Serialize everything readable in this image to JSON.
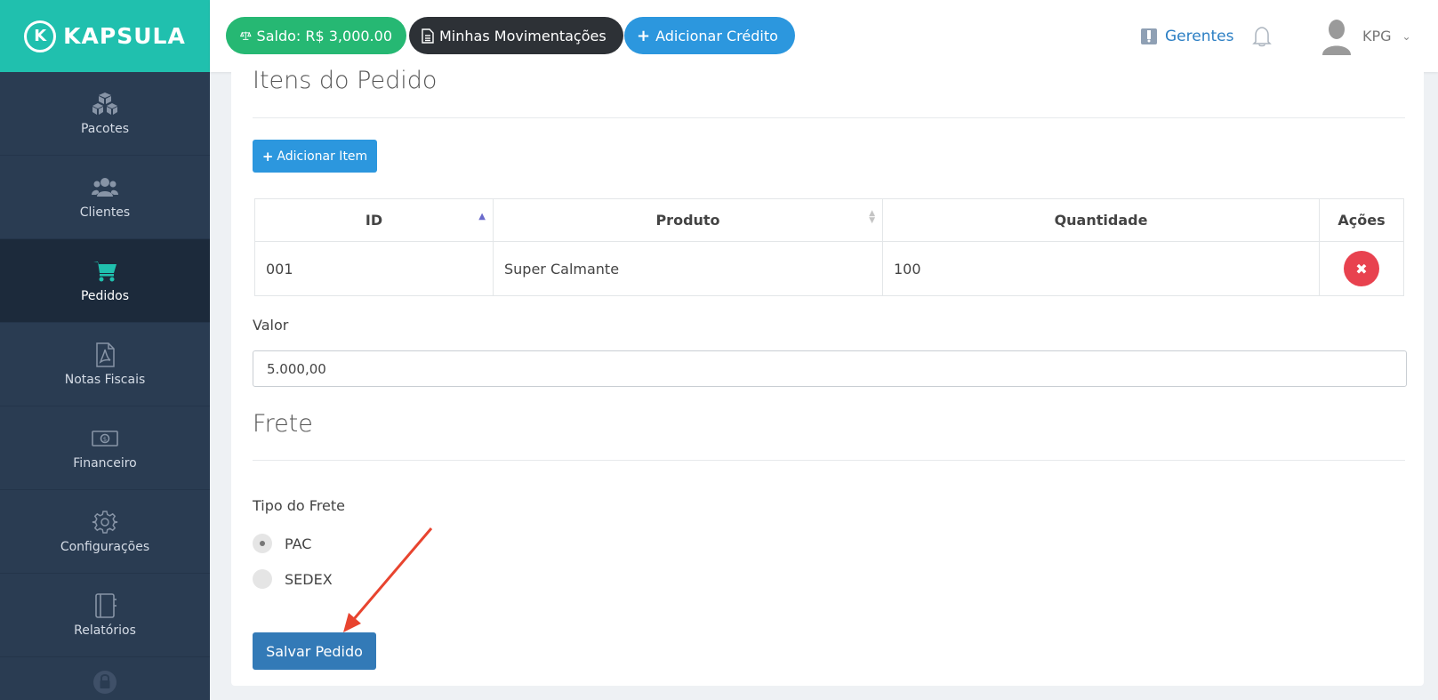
{
  "app": {
    "name": "KAPSULA",
    "logo_letter": "K"
  },
  "sidebar": {
    "items": [
      {
        "label": "Pacotes",
        "icon": "cubes-icon"
      },
      {
        "label": "Clientes",
        "icon": "users-icon"
      },
      {
        "label": "Pedidos",
        "icon": "cart-icon",
        "active": true
      },
      {
        "label": "Notas Fiscais",
        "icon": "pdf-file-icon"
      },
      {
        "label": "Financeiro",
        "icon": "money-icon"
      },
      {
        "label": "Configurações",
        "icon": "gear-icon"
      },
      {
        "label": "Relatórios",
        "icon": "notebook-icon"
      },
      {
        "label": "",
        "icon": "lock-icon"
      }
    ]
  },
  "header": {
    "saldo": "Saldo: R$ 3,000.00",
    "movimentacoes": "Minhas Movimentações",
    "adicionar_credito": "Adicionar Crédito",
    "gerentes": "Gerentes",
    "user": "KPG"
  },
  "content": {
    "itens_title": "Itens do Pedido",
    "add_item_label": "Adicionar Item",
    "table": {
      "headers": [
        "ID",
        "Produto",
        "Quantidade",
        "Ações"
      ],
      "rows": [
        {
          "id": "001",
          "produto": "Super Calmante",
          "quantidade": "100"
        }
      ]
    },
    "valor_label": "Valor",
    "valor_value": "5.000,00",
    "frete_title": "Frete",
    "tipo_frete_label": "Tipo do Frete",
    "frete_options": [
      {
        "label": "PAC",
        "checked": true
      },
      {
        "label": "SEDEX",
        "checked": false
      }
    ],
    "save_label": "Salvar Pedido"
  },
  "colors": {
    "brand": "#20c0ae",
    "sidebar": "#2a3c52",
    "saldo": "#26b873",
    "primary": "#2c97de",
    "save": "#337ab7",
    "danger": "#e8424f",
    "annotation_arrow": "#e8442f"
  }
}
